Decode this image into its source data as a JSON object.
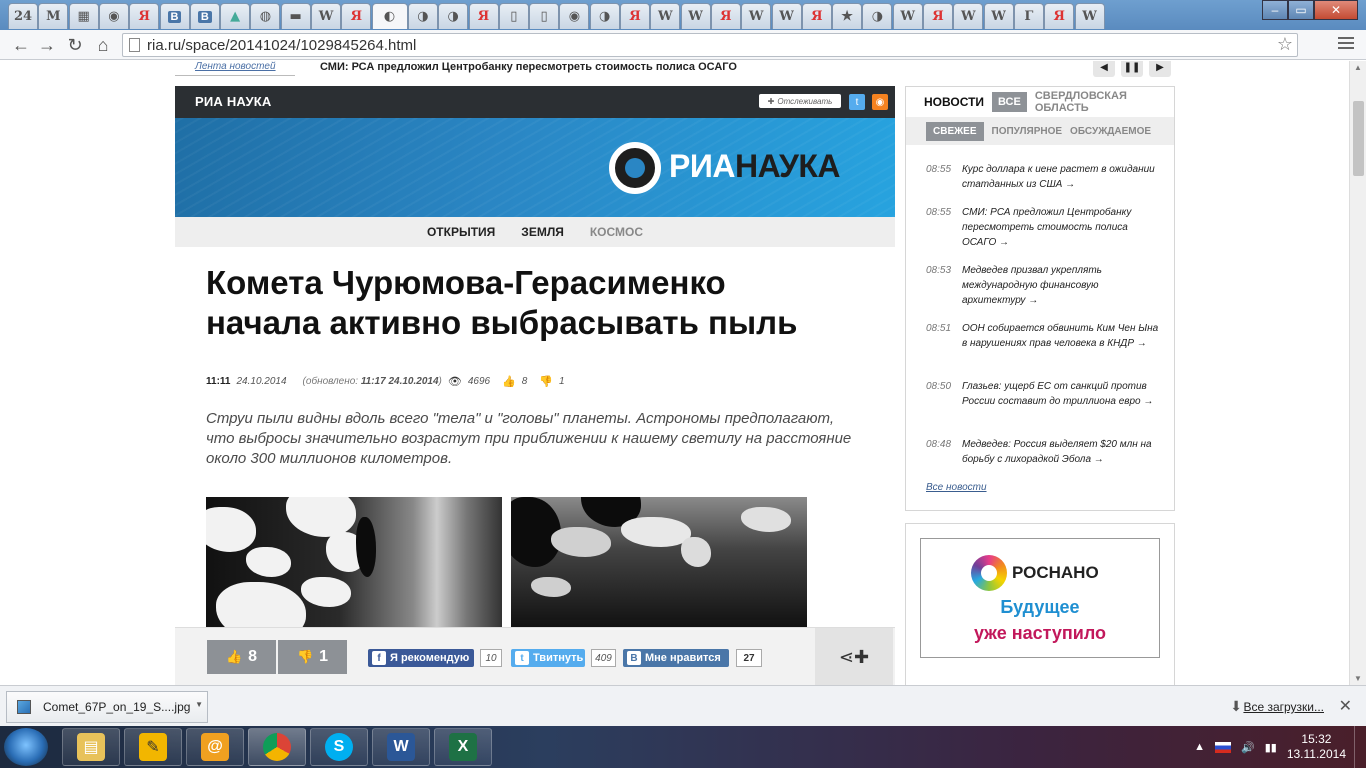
{
  "browser": {
    "tabs": [
      {
        "icon": "24",
        "kind": "other"
      },
      {
        "icon": "M",
        "kind": "mail"
      },
      {
        "icon": "▦",
        "kind": "sheets"
      },
      {
        "icon": "◉",
        "kind": "other"
      },
      {
        "icon": "Я",
        "kind": "ya"
      },
      {
        "icon": "В",
        "kind": "vk"
      },
      {
        "icon": "В",
        "kind": "vk"
      },
      {
        "icon": "▲",
        "kind": "g"
      },
      {
        "icon": "◍",
        "kind": "other"
      },
      {
        "icon": "▬",
        "kind": "other"
      },
      {
        "icon": "W",
        "kind": "wiki"
      },
      {
        "icon": "Я",
        "kind": "ya"
      },
      {
        "icon": "◐",
        "kind": "active"
      },
      {
        "icon": "◑",
        "kind": "other"
      },
      {
        "icon": "◑",
        "kind": "other"
      },
      {
        "icon": "Я",
        "kind": "ya"
      },
      {
        "icon": "▯",
        "kind": "other"
      },
      {
        "icon": "▯",
        "kind": "other"
      },
      {
        "icon": "◉",
        "kind": "other"
      },
      {
        "icon": "◑",
        "kind": "other"
      },
      {
        "icon": "Я",
        "kind": "ya"
      },
      {
        "icon": "W",
        "kind": "wiki"
      },
      {
        "icon": "W",
        "kind": "wiki"
      },
      {
        "icon": "Я",
        "kind": "ya"
      },
      {
        "icon": "W",
        "kind": "wiki"
      },
      {
        "icon": "W",
        "kind": "wiki"
      },
      {
        "icon": "Я",
        "kind": "ya"
      },
      {
        "icon": "★",
        "kind": "other"
      },
      {
        "icon": "◑",
        "kind": "other"
      },
      {
        "icon": "W",
        "kind": "wiki"
      },
      {
        "icon": "Я",
        "kind": "ya"
      },
      {
        "icon": "W",
        "kind": "wiki"
      },
      {
        "icon": "W",
        "kind": "wiki"
      },
      {
        "icon": "Г",
        "kind": "other"
      },
      {
        "icon": "Я",
        "kind": "ya"
      },
      {
        "icon": "W",
        "kind": "wiki"
      }
    ],
    "url": "ria.ru/space/20141024/1029845264.html"
  },
  "ticker": {
    "label": "Лента новостей",
    "text": "СМИ: РСА предложил Центробанку пересмотреть стоимость полиса ОСАГО"
  },
  "section": {
    "title": "РИА НАУКА",
    "follow_label": "Отслеживать",
    "banner_logo_white": "РИА",
    "banner_logo_dark": "НАУКА"
  },
  "subnav": [
    "ОТКРЫТИЯ",
    "ЗЕМЛЯ",
    "КОСМОС"
  ],
  "article": {
    "headline": "Комета Чурюмова-Герасименко начала активно выбрасывать пыль",
    "time": "11:11",
    "date": "24.10.2014",
    "updated_prefix": "(обновлено:",
    "updated_value": "11:17 24.10.2014",
    "updated_suffix": ")",
    "views": "4696",
    "likes": "8",
    "dislikes": "1",
    "lead": "Струи пыли видны вдоль всего \"тела\" и \"головы\" планеты. Астрономы предполагают, что выбросы значительно возрастут при приближении к нашему светилу на расстояние около 300 миллионов километров."
  },
  "share": {
    "vote_up": "8",
    "vote_down": "1",
    "fb_label": "Я рекомендую",
    "fb_count": "10",
    "tw_label": "Твитнуть",
    "tw_count": "409",
    "vk_label": "Мне нравится",
    "vk_count": "27"
  },
  "news": {
    "title": "НОВОСТИ",
    "filter_all": "ВСЕ",
    "filter_region": "СВЕРДЛОВСКАЯ ОБЛАСТЬ",
    "tabs": [
      "СВЕЖЕЕ",
      "ПОПУЛЯРНОЕ",
      "ОБСУЖДАЕМОЕ"
    ],
    "items": [
      {
        "time": "08:55",
        "text": "Курс доллара к иене растет в ожидании статданных из США →"
      },
      {
        "time": "08:55",
        "text": "СМИ: РСА предложил Центробанку пересмотреть стоимость полиса ОСАГО →"
      },
      {
        "time": "08:53",
        "text": "Медведев призвал укреплять международную финансовую архитектуру →"
      },
      {
        "time": "08:51",
        "text": "ООН собирается обвинить Ким Чен Ына в нарушениях прав человека в КНДР →"
      },
      {
        "time": "08:50",
        "text": "Глазьев: ущерб ЕС от санкций против России составит до триллиона евро →"
      },
      {
        "time": "08:48",
        "text": "Медведев: Россия выделяет $20 млн на борьбу с лихорадкой Эбола →"
      }
    ],
    "all_link": "Все новости"
  },
  "ad": {
    "brand": "РОСНАНО",
    "line1": "Будущее",
    "line2": "уже наступило"
  },
  "downloads": {
    "file": "Comet_67P_on_19_S....jpg",
    "all_label": "Все загрузки..."
  },
  "taskbar": {
    "time": "15:32",
    "date": "13.11.2014"
  },
  "colors": {
    "section_bar": "#2b2f33",
    "banner_blue": "#2a86c4",
    "gray_pill": "#8e9297",
    "fb": "#3b5998",
    "tw": "#55acee",
    "vk": "#4a76a8"
  }
}
